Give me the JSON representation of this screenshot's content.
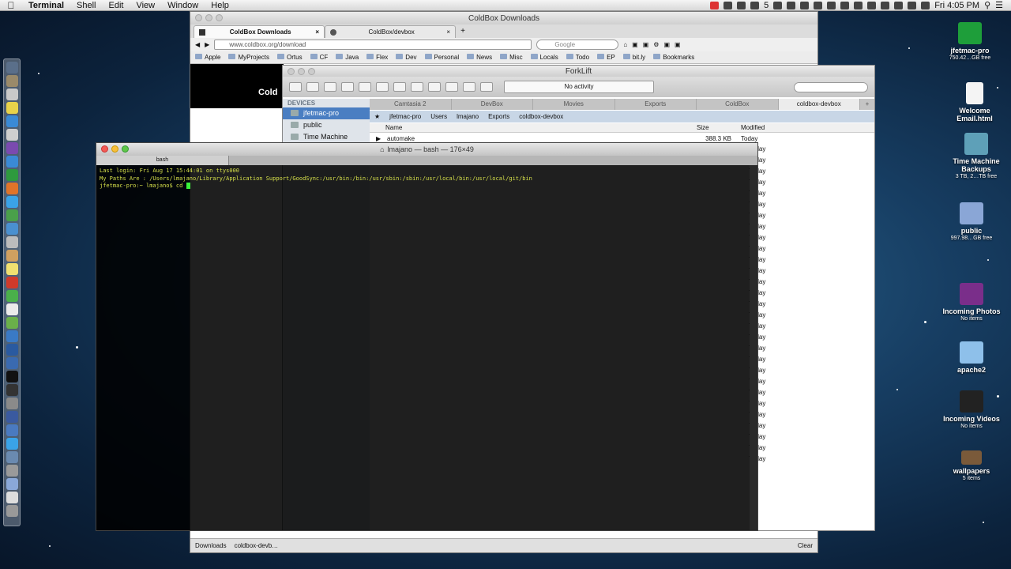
{
  "menubar": {
    "app": "Terminal",
    "items": [
      "Shell",
      "Edit",
      "View",
      "Window",
      "Help"
    ],
    "clock": "Fri 4:05 PM",
    "badge": "5"
  },
  "desktop": [
    {
      "name": "jfetmac-pro",
      "sub": "750.42…GB free",
      "color": "#1e9e3a"
    },
    {
      "name": "Welcome Email.html",
      "sub": "",
      "color": "#f4f4f4"
    },
    {
      "name": "Time Machine Backups",
      "sub": "3 TB, 2…TB free",
      "color": "#5ea0b8"
    },
    {
      "name": "public",
      "sub": "997.98…GB free",
      "color": "#8aa6d6"
    },
    {
      "name": "Incoming Photos",
      "sub": "No items",
      "color": "#7a2e8a"
    },
    {
      "name": "apache2",
      "sub": "",
      "color": "#8ec0ea"
    },
    {
      "name": "Incoming Videos",
      "sub": "No items",
      "color": "#222"
    },
    {
      "name": "wallpapers",
      "sub": "5 items",
      "color": "#7a5a3a"
    }
  ],
  "browser": {
    "title": "ColdBox Downloads",
    "tabs": [
      "ColdBox Downloads",
      "ColdBox/devbox"
    ],
    "url": "www.coldbox.org/download",
    "search_placeholder": "Google",
    "bookmarks": [
      "Apple",
      "MyProjects",
      "Ortus",
      "CF",
      "Java",
      "Flex",
      "Dev",
      "Personal",
      "News",
      "Misc",
      "Locals",
      "Todo",
      "EP",
      "bit.ly",
      "Bookmarks"
    ],
    "logo": "Cold",
    "status_items": [
      "Downloads",
      "coldbox-devb…"
    ],
    "clear": "Clear"
  },
  "forklift": {
    "title": "ForkLift",
    "activity": "No activity",
    "sidebar_head": "DEVICES",
    "sidebar": [
      "jfetmac-pro",
      "public",
      "Time Machine"
    ],
    "tabs": [
      "Camtasia 2",
      "DevBox",
      "Movies",
      "Exports",
      "ColdBox",
      "coldbox-devbox"
    ],
    "path": [
      "jfetmac-pro",
      "Users",
      "lmajano",
      "Exports",
      "coldbox-devbox"
    ],
    "columns": {
      "name": "Name",
      "size": "Size",
      "modified": "Modified"
    },
    "rows": [
      {
        "name": "automake",
        "size": "388.3 KB",
        "modified": "Today"
      }
    ],
    "today_label": "Today"
  },
  "terminal": {
    "title": "lmajano — bash — 176×49",
    "tab": "bash",
    "lines": [
      "Last login: Fri Aug 17 15:44:01 on ttys000",
      "My Paths Are : /Users/lmajano/Library/Application Support/GoodSync:/usr/bin:/bin:/usr/sbin:/sbin:/usr/local/bin:/usr/local/git/bin",
      "jfetmac-pro:~ lmajano$ cd "
    ]
  }
}
